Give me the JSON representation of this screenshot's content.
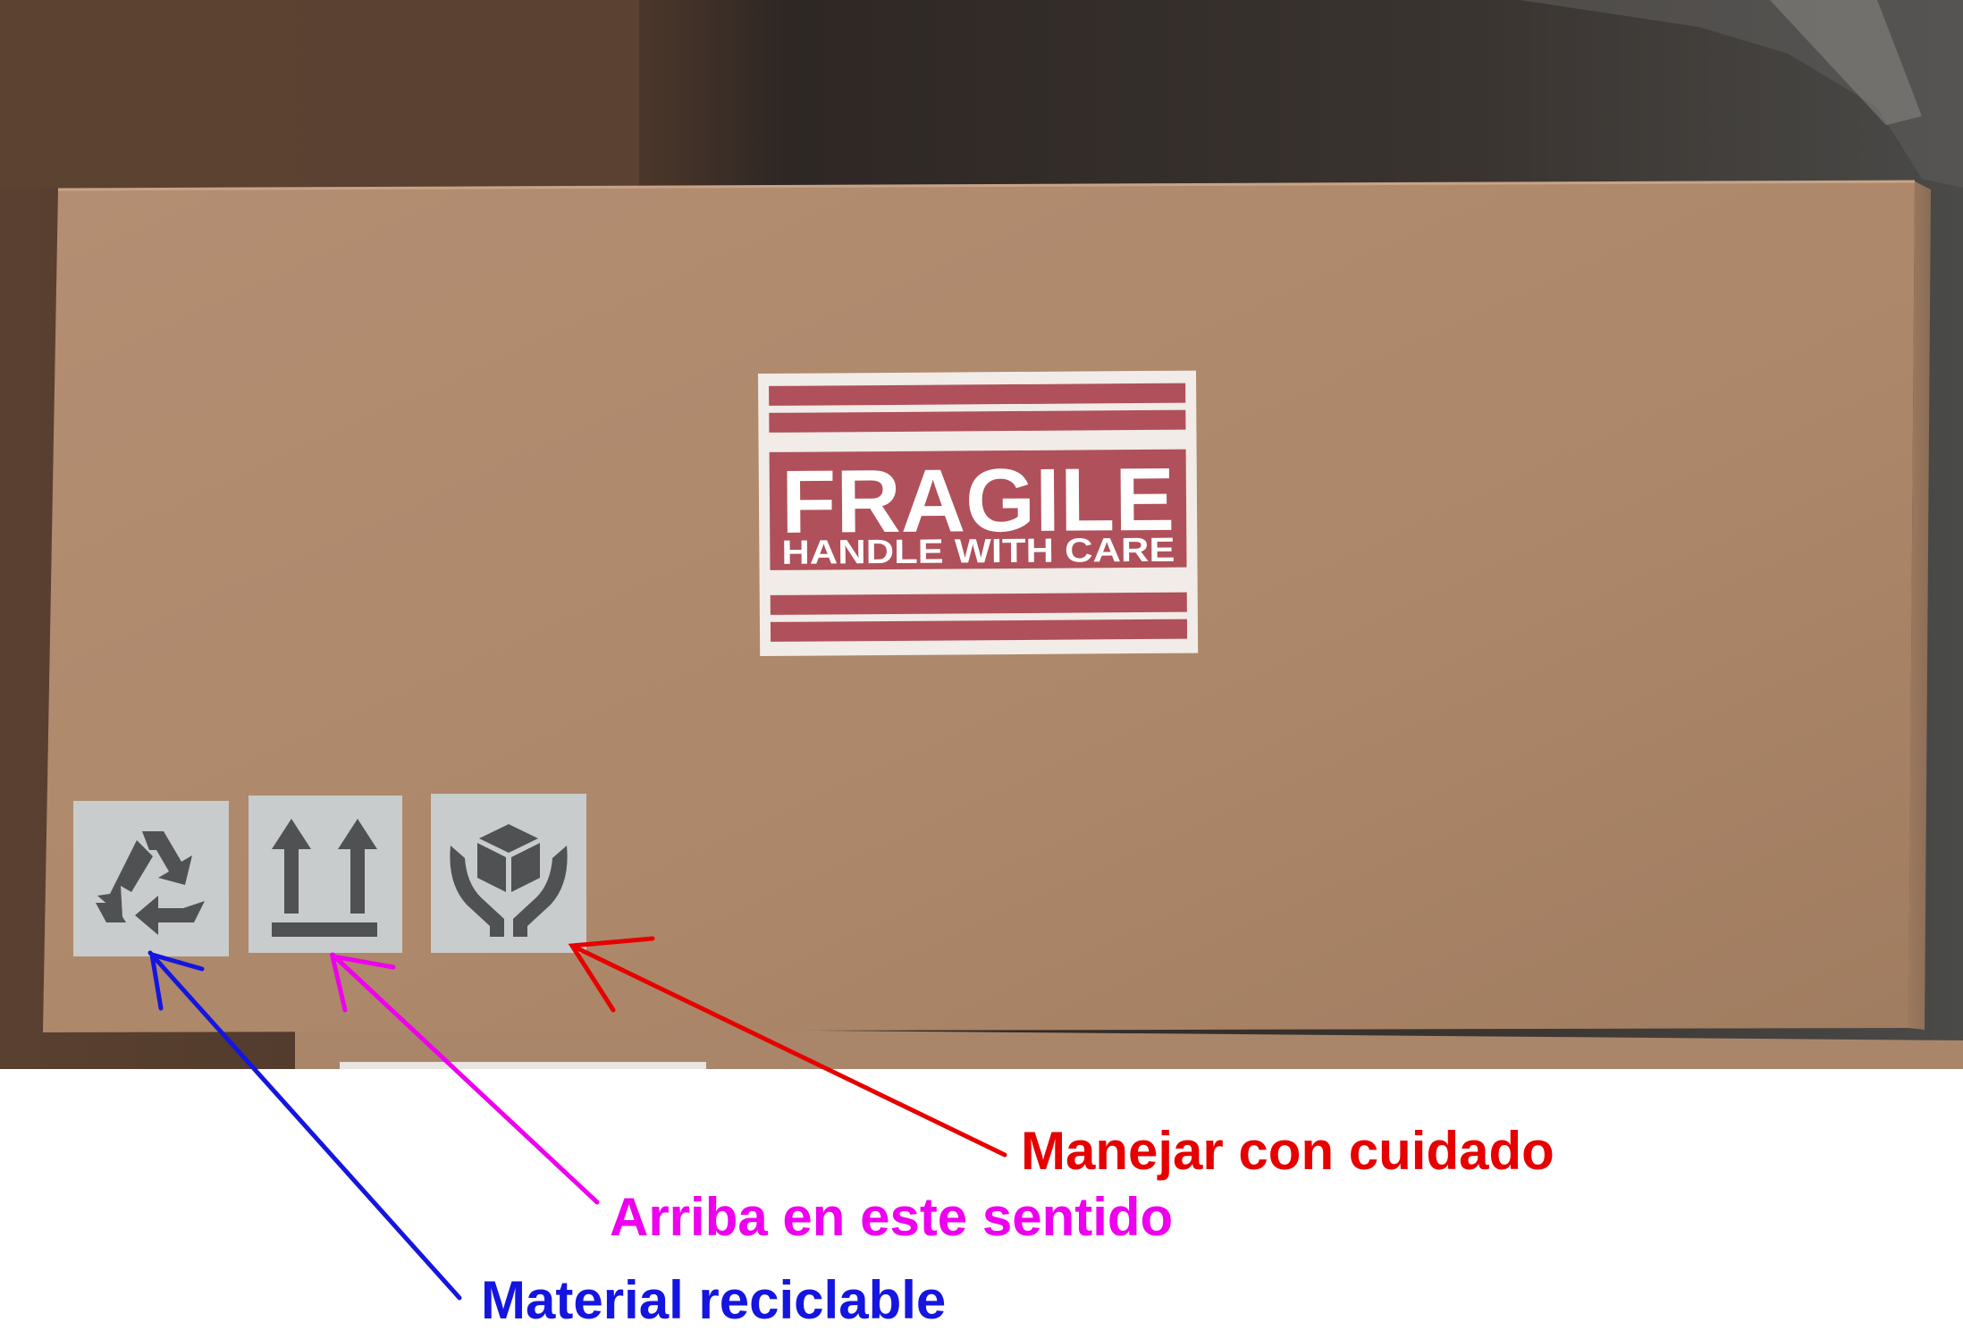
{
  "fragile_label": {
    "title": "FRAGILE",
    "subtitle": "HANDLE WITH CARE"
  },
  "symbols": [
    {
      "icon": "recycle-icon"
    },
    {
      "icon": "this-way-up-icon"
    },
    {
      "icon": "handle-with-care-icon"
    }
  ],
  "annotations": {
    "handle_with_care": {
      "text": "Manejar con cuidado",
      "color": "#e60000"
    },
    "this_way_up": {
      "text": "Arriba en este sentido",
      "color": "#ee00ee"
    },
    "recyclable": {
      "text": "Material reciclable",
      "color": "#1515e0"
    }
  },
  "colors": {
    "cardboard": "#b08a6e",
    "fragile_red": "#b0505a",
    "background": "#3a3430"
  }
}
